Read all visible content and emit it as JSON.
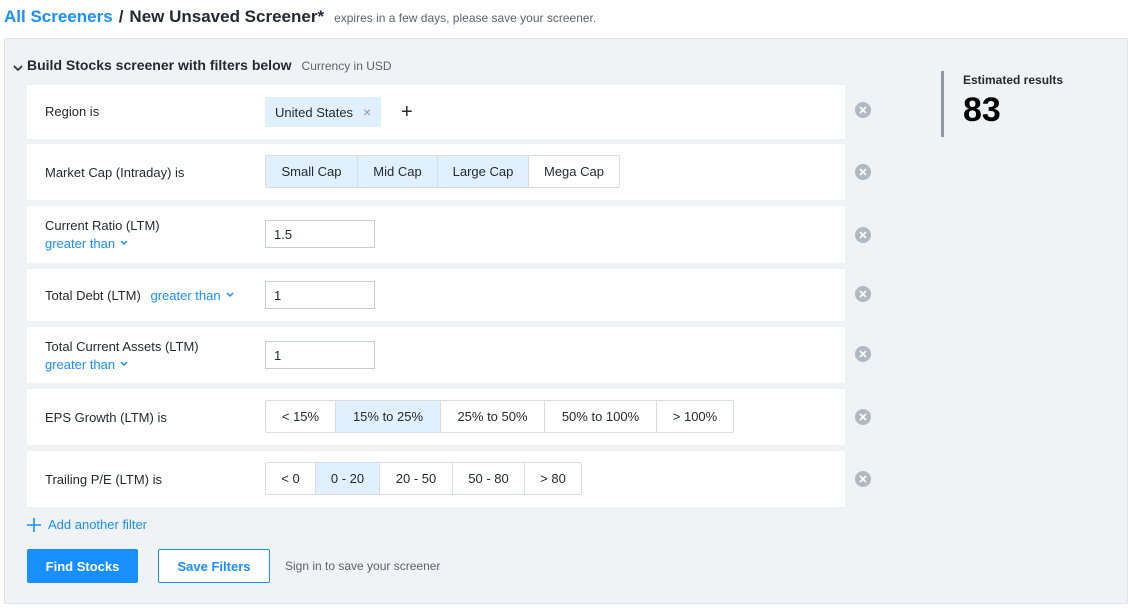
{
  "header": {
    "all_screeners": "All Screeners",
    "separator": "/",
    "current": "New Unsaved Screener*",
    "expires": "expires in a few days, please save your screener."
  },
  "build": {
    "title": "Build Stocks screener with filters below",
    "currency": "Currency in USD"
  },
  "filters": {
    "region": {
      "label": "Region  is",
      "chip": "United States",
      "chip_remove": "×",
      "add": "+"
    },
    "market_cap": {
      "label": "Market Cap (Intraday)  is",
      "options": [
        "Small Cap",
        "Mid Cap",
        "Large Cap",
        "Mega Cap"
      ],
      "selected": [
        "Small Cap",
        "Mid Cap",
        "Large Cap"
      ]
    },
    "current_ratio": {
      "label": "Current Ratio (LTM)",
      "operator": "greater than",
      "value": "1.5"
    },
    "total_debt": {
      "label": "Total Debt (LTM)",
      "operator": "greater than",
      "value": "1"
    },
    "total_current_assets": {
      "label": "Total Current Assets (LTM)",
      "operator": "greater than",
      "value": "1"
    },
    "eps_growth": {
      "label": "EPS Growth (LTM)  is",
      "options": [
        "< 15%",
        "15% to 25%",
        "25% to 50%",
        "50% to 100%",
        "> 100%"
      ],
      "selected": [
        "15% to 25%"
      ]
    },
    "trailing_pe": {
      "label": "Trailing P/E (LTM)  is",
      "options": [
        "< 0",
        "0 - 20",
        "20 - 50",
        "50 - 80",
        "> 80"
      ],
      "selected": [
        "0 - 20"
      ]
    }
  },
  "actions": {
    "add_filter": "Add another filter",
    "find": "Find Stocks",
    "save": "Save Filters",
    "signin": "Sign in to save your screener"
  },
  "estimate": {
    "label": "Estimated results",
    "value": "83"
  },
  "colors": {
    "accent": "#188fff",
    "selected_bg": "#e0f0ff",
    "panel_bg": "#f0f3f5"
  },
  "icons": {
    "collapse": "chevron-down-icon",
    "remove": "remove-circle-icon",
    "dropdown": "chevron-down-icon",
    "add": "plus-icon"
  }
}
